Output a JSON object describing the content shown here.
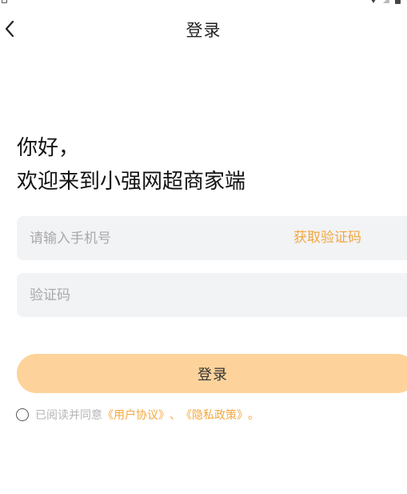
{
  "nav": {
    "title": "登录",
    "back_icon": "chevron-left-icon"
  },
  "greeting": {
    "line1": "你好，",
    "line2": "欢迎来到小强网超商家端"
  },
  "form": {
    "phone_placeholder": "请输入手机号",
    "phone_value": "",
    "get_code_label": "获取验证码",
    "code_placeholder": "验证码",
    "code_value": "",
    "login_label": "登录"
  },
  "agreement": {
    "prefix": "已阅读并同意",
    "user_agreement": "《用户协议》",
    "separator": "、",
    "privacy_policy": "《隐私政策》",
    "suffix": "。",
    "checked": false
  },
  "colors": {
    "accent": "#f3a73e",
    "login_button": "#fdd39b",
    "input_background": "#f2f3f5"
  }
}
